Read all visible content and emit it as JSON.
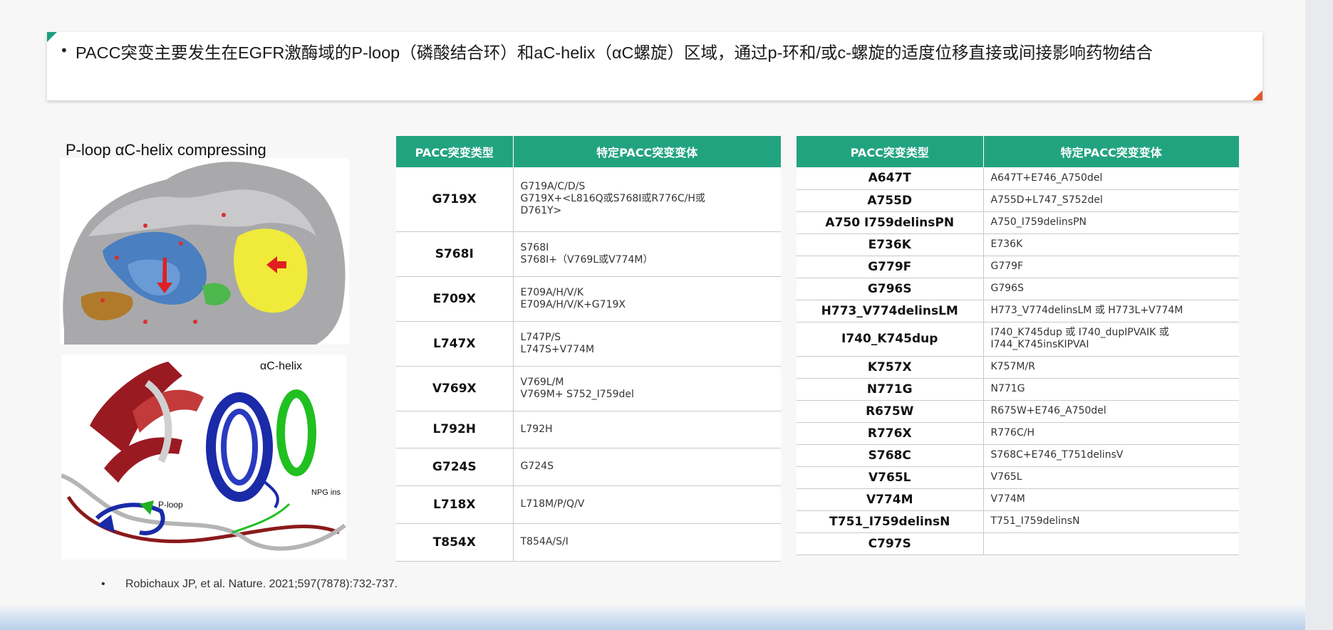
{
  "header": {
    "bullet": "•",
    "text": "PACC突变主要发生在EGFR激酶域的P-loop（磷酸结合环）和aC-helix（αC螺旋）区域，通过p-环和/或c-螺旋的适度位移直接或间接影响药物结合"
  },
  "figure": {
    "title": "P-loop αC-helix compressing",
    "label_ac_helix": "αC-helix",
    "label_p_loop": "P-loop",
    "label_npg_ins": "NPG ins"
  },
  "table_left": {
    "headers": [
      "PACC突变类型",
      "特定PACC突变变体"
    ],
    "rows": [
      {
        "type": "G719X",
        "variants": [
          "G719A/C/D/S",
          "G719X+<L816Q或S768I或R776C/H或",
          "D761Y>"
        ]
      },
      {
        "type": "S768I",
        "variants": [
          "S768I",
          "S768I+（V769L或V774M）"
        ]
      },
      {
        "type": "E709X",
        "variants": [
          "E709A/H/V/K",
          "E709A/H/V/K+G719X"
        ]
      },
      {
        "type": "L747X",
        "variants": [
          "L747P/S",
          "L747S+V774M"
        ]
      },
      {
        "type": "V769X",
        "variants": [
          "V769L/M",
          "V769M+ S752_I759del"
        ]
      },
      {
        "type": "L792H",
        "variants": [
          "L792H"
        ]
      },
      {
        "type": "G724S",
        "variants": [
          "G724S"
        ]
      },
      {
        "type": "L718X",
        "variants": [
          "L718M/P/Q/V"
        ]
      },
      {
        "type": "T854X",
        "variants": [
          "T854A/S/I"
        ]
      }
    ]
  },
  "table_right": {
    "headers": [
      "PACC突变类型",
      "特定PACC突变变体"
    ],
    "rows": [
      {
        "type": "A647T",
        "variants": [
          "A647T+E746_A750del"
        ]
      },
      {
        "type": "A755D",
        "variants": [
          "A755D+L747_S752del"
        ]
      },
      {
        "type": "A750 I759delinsPN",
        "variants": [
          "A750_I759delinsPN"
        ]
      },
      {
        "type": "E736K",
        "variants": [
          "E736K"
        ]
      },
      {
        "type": "G779F",
        "variants": [
          "G779F"
        ]
      },
      {
        "type": "G796S",
        "variants": [
          "G796S"
        ]
      },
      {
        "type": "H773_V774delinsLM",
        "variants": [
          "H773_V774delinsLM 或 H773L+V774M"
        ]
      },
      {
        "type": "I740_K745dup",
        "variants": [
          "I740_K745dup 或 I740_dupIPVAIK 或",
          "I744_K745insKIPVAI"
        ]
      },
      {
        "type": "K757X",
        "variants": [
          "K757M/R"
        ]
      },
      {
        "type": "N771G",
        "variants": [
          "N771G"
        ]
      },
      {
        "type": "R675W",
        "variants": [
          "R675W+E746_A750del"
        ]
      },
      {
        "type": "R776X",
        "variants": [
          "R776C/H"
        ]
      },
      {
        "type": "S768C",
        "variants": [
          "S768C+E746_T751delinsV"
        ]
      },
      {
        "type": "V765L",
        "variants": [
          "V765L"
        ]
      },
      {
        "type": "V774M",
        "variants": [
          "V774M"
        ]
      },
      {
        "type": "T751_I759delinsN",
        "variants": [
          "T751_I759delinsN"
        ]
      },
      {
        "type": "C797S",
        "variants": [
          ""
        ]
      }
    ]
  },
  "reference": {
    "bullet": "•",
    "text": "Robichaux JP, et al. Nature. 2021;597(7878):732-737."
  },
  "colors": {
    "table_header": "#22a37f",
    "corner_accent_green": "#1f9e82",
    "corner_accent_orange": "#e3582a"
  }
}
